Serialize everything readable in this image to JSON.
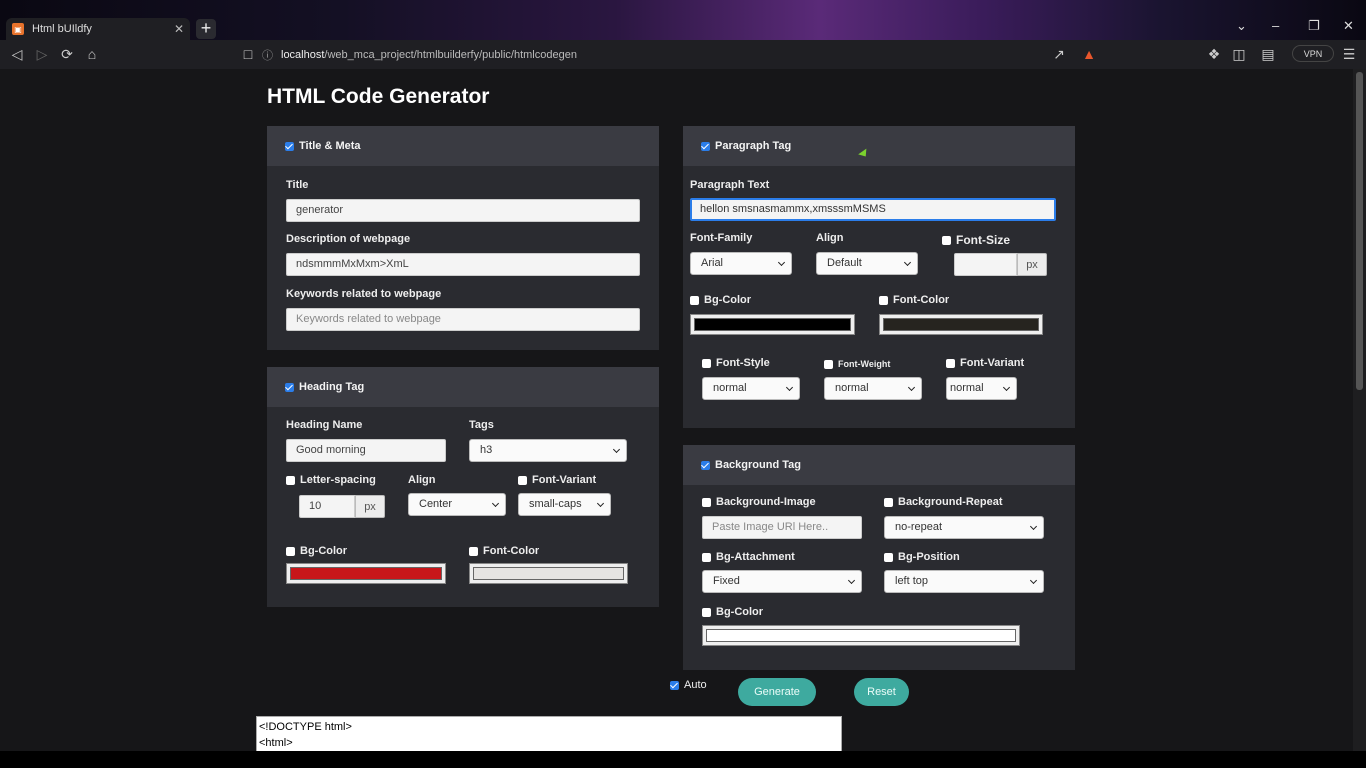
{
  "browser": {
    "tab_title": "Html bUIldfy",
    "url_host": "localhost",
    "url_path": "/web_mca_project/htmlbuilderfy/public/htmlcodegen",
    "vpn_label": "VPN"
  },
  "page": {
    "heading": "HTML Code Generator"
  },
  "title_meta": {
    "header": "Title & Meta",
    "enabled": true,
    "title_label": "Title",
    "title_value": "generator",
    "desc_label": "Description of webpage",
    "desc_value": "ndsmmmMxMxm>XmL",
    "keywords_label": "Keywords related to webpage",
    "keywords_placeholder": "Keywords related to webpage"
  },
  "heading_tag": {
    "header": "Heading Tag",
    "enabled": true,
    "name_label": "Heading Name",
    "name_value": "Good morning",
    "tags_label": "Tags",
    "tags_value": "h3",
    "letter_spacing_label": "Letter-spacing",
    "letter_spacing_value": "10",
    "unit": "px",
    "align_label": "Align",
    "align_value": "Center",
    "font_variant_label": "Font-Variant",
    "font_variant_value": "small-caps",
    "bg_color_label": "Bg-Color",
    "bg_color": "#c8161a",
    "font_color_label": "Font-Color",
    "font_color": "#e6e4e2"
  },
  "paragraph_tag": {
    "header": "Paragraph Tag",
    "enabled": true,
    "text_label": "Paragraph Text",
    "text_value": "hellon smsnasmammx,xmsssmMSMS",
    "font_family_label": "Font-Family",
    "font_family_value": "Arial",
    "align_label": "Align",
    "align_value": "Default",
    "font_size_label": "Font-Size",
    "unit": "px",
    "bg_color_label": "Bg-Color",
    "bg_color": "#000000",
    "font_color_label": "Font-Color",
    "font_color": "#26241f",
    "font_style_label": "Font-Style",
    "font_style_value": "normal",
    "font_weight_label": "Font-Weight",
    "font_weight_value": "normal",
    "font_variant_label": "Font-Variant",
    "font_variant_value": "normal"
  },
  "background_tag": {
    "header": "Background Tag",
    "enabled": true,
    "image_label": "Background-Image",
    "image_placeholder": "Paste Image URl Here..",
    "repeat_label": "Background-Repeat",
    "repeat_value": "no-repeat",
    "attachment_label": "Bg-Attachment",
    "attachment_value": "Fixed",
    "position_label": "Bg-Position",
    "position_value": "left top",
    "bg_color_label": "Bg-Color",
    "bg_color": "#ffffff"
  },
  "actions": {
    "auto_label": "Auto",
    "auto_checked": true,
    "generate_label": "Generate",
    "reset_label": "Reset"
  },
  "output": {
    "line1": "<!DOCTYPE html>",
    "line2": "<html>"
  }
}
